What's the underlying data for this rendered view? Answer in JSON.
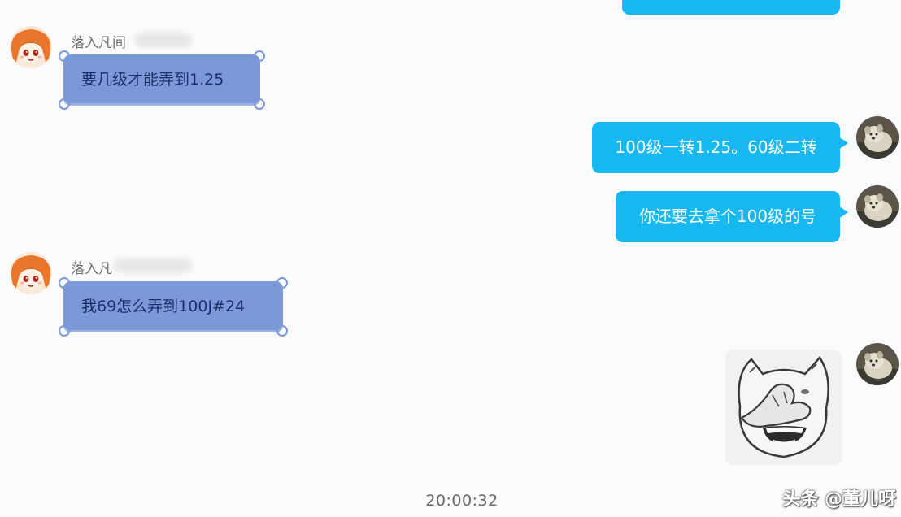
{
  "colors": {
    "background": "#fbfbfd",
    "incoming_bubble": "#7b98d8",
    "incoming_text": "#1d2f66",
    "outgoing_bubble": "#17b7f1",
    "outgoing_text": "#ffffff"
  },
  "messages": [
    {
      "direction": "incoming",
      "sender": "落入凡间",
      "text": "要几级才能弄到1.25",
      "avatar_icon": "cartoon-girl-avatar-icon"
    },
    {
      "direction": "outgoing",
      "text": "100级一转1.25。60级二转",
      "avatar_icon": "dog-photo-avatar-icon"
    },
    {
      "direction": "outgoing",
      "text": "你还要去拿个100级的号",
      "avatar_icon": "dog-photo-avatar-icon"
    },
    {
      "direction": "incoming",
      "sender": "落入凡",
      "text": "我69怎么弄到100J#24",
      "avatar_icon": "cartoon-girl-avatar-icon"
    },
    {
      "direction": "outgoing",
      "sticker": "covering-face-cat-sticker",
      "avatar_icon": "dog-photo-avatar-icon"
    }
  ],
  "timestamp": "20:00:32",
  "watermark": "头条 @董儿呀"
}
